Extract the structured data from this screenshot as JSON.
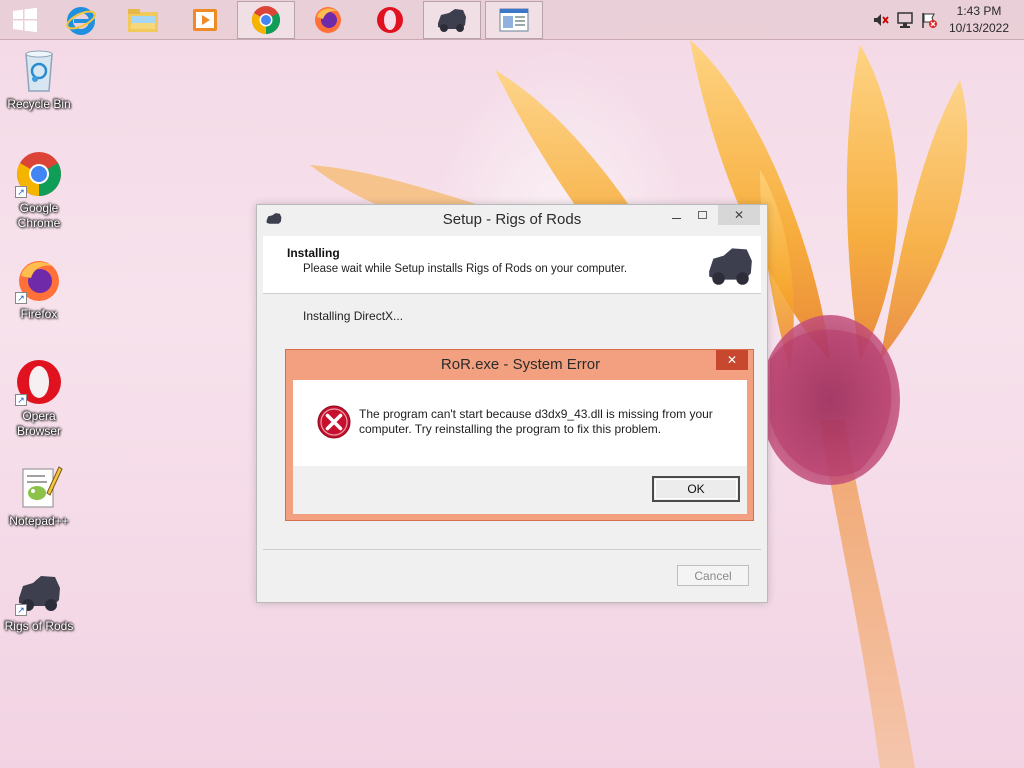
{
  "taskbar": {
    "apps": [
      {
        "name": "start-button"
      },
      {
        "name": "internet-explorer"
      },
      {
        "name": "file-explorer"
      },
      {
        "name": "media-player"
      },
      {
        "name": "google-chrome"
      },
      {
        "name": "firefox"
      },
      {
        "name": "opera"
      },
      {
        "name": "rigs-of-rods"
      },
      {
        "name": "setup-window"
      }
    ],
    "clock": {
      "time": "1:43 PM",
      "date": "10/13/2022"
    }
  },
  "desktop": {
    "icons": [
      {
        "label": "Recycle Bin"
      },
      {
        "label": "Google Chrome"
      },
      {
        "label": "Firefox"
      },
      {
        "label": "Opera Browser"
      },
      {
        "label": "Notepad++"
      },
      {
        "label": "Rigs of Rods"
      }
    ]
  },
  "setup": {
    "title": "Setup - Rigs of Rods",
    "header_title": "Installing",
    "header_subtitle": "Please wait while Setup installs Rigs of Rods on your computer.",
    "status": "Installing DirectX...",
    "cancel_label": "Cancel"
  },
  "error": {
    "title": "RoR.exe - System Error",
    "message": "The program can't start because d3dx9_43.dll is missing from your computer. Try reinstalling the program to fix this problem.",
    "ok_label": "OK"
  },
  "colors": {
    "taskbar": "#e8ced6",
    "error_frame": "#f2a07f",
    "close_red": "#c7472f",
    "error_icon": "#c8102e"
  }
}
